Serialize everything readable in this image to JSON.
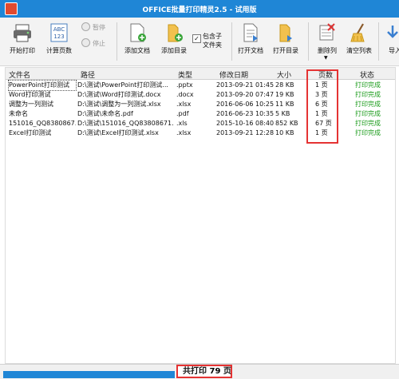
{
  "window": {
    "title": "OFFICE批量打印精灵2.5 - 试用版"
  },
  "toolbar": {
    "start_print": "开始打印",
    "count_pages": "计算页数",
    "pause": "暂停",
    "stop": "停止",
    "add_doc": "添加文档",
    "add_dir": "添加目录",
    "include_subfolders": "包含子文件夹",
    "open_doc": "打开文档",
    "open_dir": "打开目录",
    "delete_col": "删除列",
    "clear_list": "清空列表",
    "import": "导入"
  },
  "table": {
    "headers": [
      "文件名",
      "路径",
      "类型",
      "修改日期",
      "大小",
      "页数",
      "状态"
    ],
    "rows": [
      {
        "name": "PowerPoint打印测试",
        "path": "D:\\测试\\PowerPoint打印测试...",
        "type": ".pptx",
        "date": "2013-09-21 01:45",
        "size": "28 KB",
        "pages": "1 页",
        "status": "打印完成"
      },
      {
        "name": "Word打印测试",
        "path": "D:\\测试\\Word打印测试.docx",
        "type": ".docx",
        "date": "2013-09-20 07:47",
        "size": "19 KB",
        "pages": "3 页",
        "status": "打印完成"
      },
      {
        "name": "调整为一列测试",
        "path": "D:\\测试\\调整为一列测试.xlsx",
        "type": ".xlsx",
        "date": "2016-06-06 10:25",
        "size": "11 KB",
        "pages": "6 页",
        "status": "打印完成"
      },
      {
        "name": "未命名",
        "path": "D:\\测试\\未命名.pdf",
        "type": ".pdf",
        "date": "2016-06-23 10:35",
        "size": "5 KB",
        "pages": "1 页",
        "status": "打印完成"
      },
      {
        "name": "151016_QQ8380867...",
        "path": "D:\\测试\\151016_QQ83808671...",
        "type": ".xls",
        "date": "2015-10-16 08:40",
        "size": "852 KB",
        "pages": "67 页",
        "status": "打印完成"
      },
      {
        "name": "Excel打印测试",
        "path": "D:\\测试\\Excel打印测试.xlsx",
        "type": ".xlsx",
        "date": "2013-09-21 12:28",
        "size": "10 KB",
        "pages": "1 页",
        "status": "打印完成"
      }
    ]
  },
  "statusbar": {
    "total_prefix": "共打印",
    "total_value": "79",
    "total_suffix": "页"
  },
  "colors": {
    "accent": "#1f86d6",
    "highlight": "#e53333",
    "status_ok": "#1a9b1a"
  }
}
